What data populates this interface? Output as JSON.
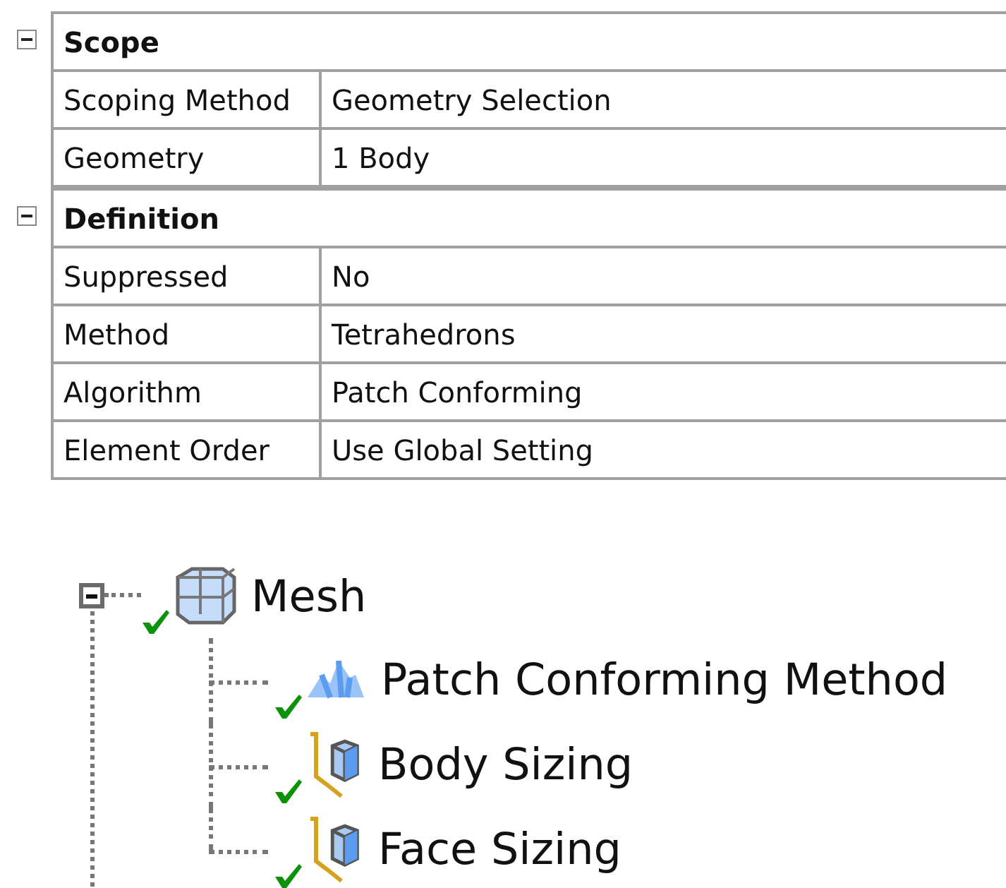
{
  "details": {
    "groups": [
      {
        "title": "Scope",
        "expanded": true,
        "rows": [
          {
            "label": "Scoping Method",
            "value": "Geometry Selection"
          },
          {
            "label": "Geometry",
            "value": "1 Body"
          }
        ]
      },
      {
        "title": "Definition",
        "expanded": true,
        "rows": [
          {
            "label": "Suppressed",
            "value": "No"
          },
          {
            "label": "Method",
            "value": "Tetrahedrons"
          },
          {
            "label": "Algorithm",
            "value": "Patch Conforming"
          },
          {
            "label": "Element Order",
            "value": "Use Global Setting"
          }
        ]
      }
    ]
  },
  "tree": {
    "root": {
      "label": "Mesh",
      "kind": "mesh",
      "expanded": true,
      "checked": true,
      "children": [
        {
          "label": "Patch Conforming Method",
          "kind": "method",
          "checked": true
        },
        {
          "label": "Body Sizing",
          "kind": "sizing",
          "checked": true
        },
        {
          "label": "Face Sizing",
          "kind": "sizing",
          "checked": true
        }
      ]
    }
  }
}
